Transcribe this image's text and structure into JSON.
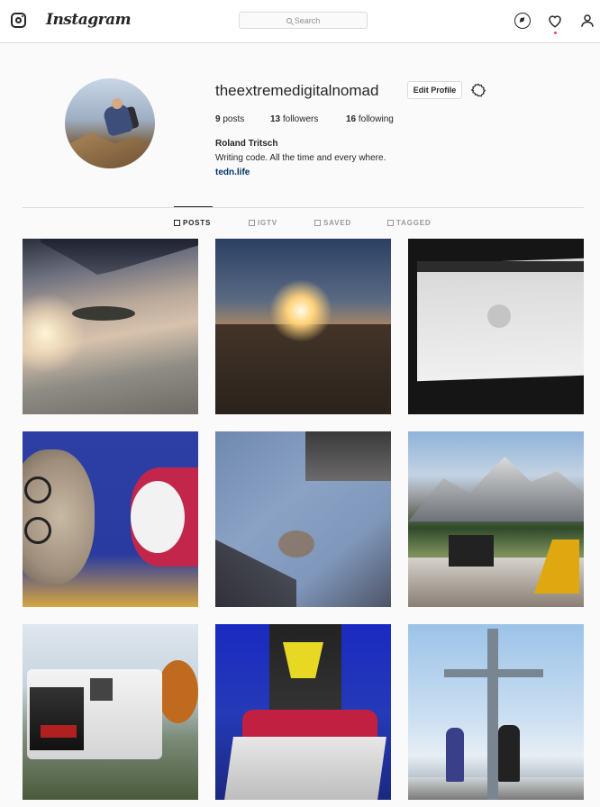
{
  "header": {
    "brand": "Instagram",
    "search_placeholder": "Search",
    "icons": [
      "instagram-glyph-icon",
      "search-icon",
      "compass-icon",
      "heart-icon",
      "person-icon"
    ]
  },
  "profile": {
    "username": "theextremedigitalnomad",
    "edit_button": "Edit Profile",
    "stats": {
      "posts_count": "9",
      "posts_label": " posts",
      "followers_count": "13",
      "followers_label": " followers",
      "following_count": "16",
      "following_label": " following"
    },
    "full_name": "Roland Tritsch",
    "bio": "Writing code. All the time and every where.",
    "link": "tedn.life"
  },
  "tabs": [
    {
      "label": "POSTS",
      "active": true
    },
    {
      "label": "IGTV",
      "active": false
    },
    {
      "label": "SAVED",
      "active": false
    },
    {
      "label": "TAGGED",
      "active": false
    }
  ],
  "colors": {
    "link": "#003569",
    "notification_dot": "#ed4956",
    "border": "#dbdbdb"
  }
}
